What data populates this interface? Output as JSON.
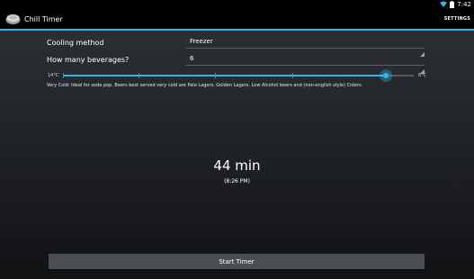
{
  "status_bar": {
    "time": "7:42",
    "icons": [
      "wifi-icon",
      "battery-icon"
    ]
  },
  "action_bar": {
    "title": "Chill Timer",
    "settings_label": "SETTINGS",
    "icon": "app-icon"
  },
  "form": {
    "cooling_method": {
      "label": "Cooling method",
      "value": "Freezer"
    },
    "beverage_count": {
      "label": "How many beverages?",
      "value": "6"
    }
  },
  "temperature_slider": {
    "min_label": "14°C",
    "max_label": "6°C",
    "level_fraction": 0.92,
    "accent_color": "#33b5e5"
  },
  "description": "Very Cold: Ideal for soda pop. Beers best served very cold are Pale Lagers, Golden Lagers, Low Alcohol beers and (non-english style) Ciders.",
  "timer": {
    "duration": "44 min",
    "end_time": "(8:26 PM)"
  },
  "start_button": {
    "label": "Start Timer"
  }
}
